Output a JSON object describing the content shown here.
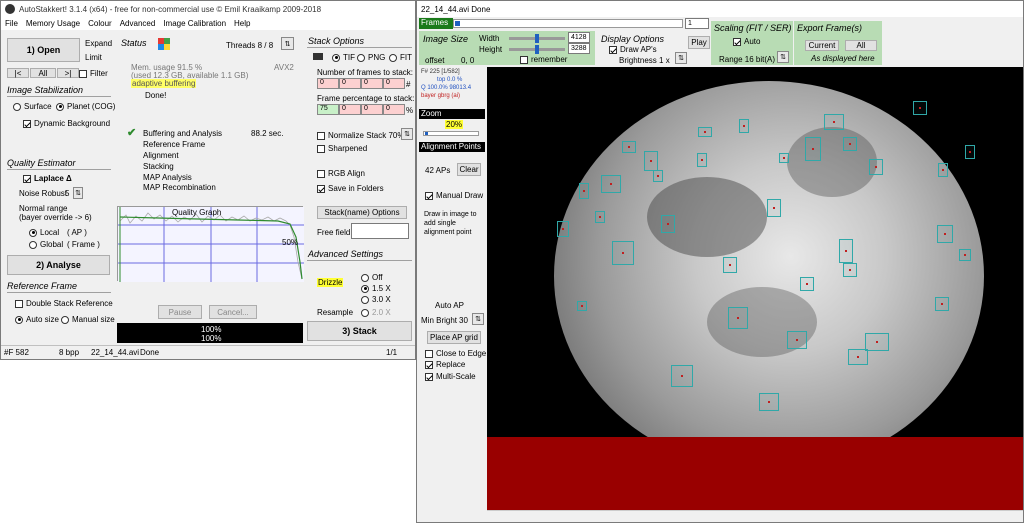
{
  "left": {
    "title": "AutoStakkert! 3.1.4 (x64) - free for non-commercial use © Emil Kraaikamp 2009-2018",
    "menu": [
      "File",
      "Memory Usage",
      "Colour",
      "Advanced",
      "Image Calibration",
      "Help"
    ],
    "open_btn": "1) Open",
    "expand": "Expand",
    "limit": "Limit",
    "nav": [
      "|<",
      "All",
      ">|"
    ],
    "filter": "Filter",
    "stab_title": "Image Stabilization",
    "surface": "Surface",
    "planet": "Planet (COG)",
    "dynamic_bg": "Dynamic Background",
    "quality_title": "Quality Estimator",
    "laplace": "Laplace Δ",
    "noise_robust": "Noise Robust",
    "noise_val": "5",
    "normal_range": "Normal range",
    "bayer_override": "(bayer override -> 6)",
    "local": "Local",
    "local_ap": "( AP )",
    "global": "Global",
    "global_frame": "( Frame )",
    "analyse_btn": "2) Analyse",
    "ref_title": "Reference Frame",
    "double_stack": "Double Stack Reference",
    "auto_size": "Auto size",
    "manual_size": "Manual size",
    "status_title": "Status",
    "threads": "Threads 8 / 8",
    "mem_usage": "Mem. usage 91.5 %",
    "mem_used": "(used 12.3 GB, available 1.1 GB)",
    "adaptive": "adaptive buffering",
    "done": "Done!",
    "avx": "AVX2",
    "buffering": "Buffering and Analysis",
    "buffering_time": "88.2 sec.",
    "steps": [
      "Reference Frame",
      "Alignment",
      "Stacking",
      "MAP Analysis",
      "MAP Recombination"
    ],
    "quality_graph": "Quality Graph",
    "graph_pct": "50%",
    "pause": "Pause",
    "cancel": "Cancel...",
    "progress1": "100%",
    "progress2": "100%",
    "stack_title": "Stack Options",
    "tif": "TIF",
    "png": "PNG",
    "fit": "FIT",
    "num_frames": "Number of frames to stack:",
    "frame_row": [
      "0",
      "0",
      "0",
      "0"
    ],
    "hash": "#",
    "frame_pct": "Frame percentage to stack:",
    "pct_row": [
      "75",
      "0",
      "0",
      "0"
    ],
    "pct": "%",
    "normalize": "Normalize Stack 70%",
    "sharpened": "Sharpened",
    "rgb_align": "RGB Align",
    "save_folders": "Save in Folders",
    "stack_name": "Stack(name) Options",
    "free_field": "Free field",
    "adv_title": "Advanced Settings",
    "drizzle": "Drizzle",
    "off": "Off",
    "d15": "1.5 X",
    "d30": "3.0 X",
    "resample": "Resample",
    "r20": "2.0 X",
    "stack_btn": "3) Stack",
    "status_bar": [
      "#F 582",
      "8 bpp",
      "22_14_44.avi",
      "Done",
      "1/1"
    ]
  },
  "right": {
    "title": "22_14_44.avi   Done",
    "frames": "Frames",
    "frame_num": "1",
    "image_size": "Image Size",
    "width_lbl": "Width",
    "width_val": "4128",
    "height_lbl": "Height",
    "height_val": "3288",
    "offset": "offset",
    "offset_val": "0, 0",
    "remember": "remember",
    "display_opts": "Display Options",
    "draw_aps": "Draw AP's",
    "brightness": "Brightness 1 x",
    "play": "Play",
    "scaling": "Scaling (FIT / SER)",
    "auto": "Auto",
    "range": "Range 16 bit(A)",
    "export": "Export Frame(s)",
    "current": "Current",
    "all": "All",
    "as_displayed": "As displayed here",
    "info1": "F# 225 [1/582]",
    "info2": "top 0.0 %",
    "info3": "Q 100.0%  98013.4",
    "info4": "bayer gbrg (ai)",
    "zoom": "Zoom",
    "zoom_val": "20%",
    "ap_title": "Alignment Points",
    "aps": "42 APs",
    "clear": "Clear",
    "manual_draw": "Manual Draw",
    "draw_hint": "Draw in image to add single alignment point",
    "auto_ap": "Auto AP",
    "min_bright": "Min Bright",
    "min_bright_val": "30",
    "place_grid": "Place AP grid",
    "close_edge": "Close to Edge",
    "replace": "Replace",
    "multiscale": "Multi-Scale"
  },
  "colors": {
    "frames_bar": "#1a7a1a",
    "panel_green": "#c8e6c4",
    "dark_red": "#990000"
  }
}
